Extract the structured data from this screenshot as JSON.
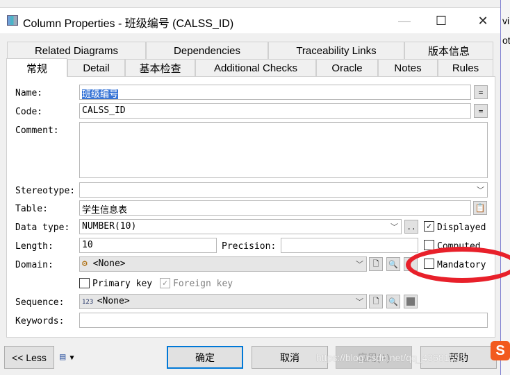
{
  "window": {
    "title": "Column Properties - 班级编号 (CALSS_ID)",
    "minimize": "—",
    "maximize": "☐",
    "close": "✕"
  },
  "background_app": {
    "text1": "vi",
    "text2": "ot"
  },
  "tabs_row1": [
    "Related Diagrams",
    "Dependencies",
    "Traceability Links",
    "版本信息"
  ],
  "tabs_row2": [
    "常规",
    "Detail",
    "基本检查",
    "Additional Checks",
    "Oracle",
    "Notes",
    "Rules"
  ],
  "form": {
    "name_label": "Name:",
    "name_value": "班级编号",
    "code_label": "Code:",
    "code_value": "CALSS_ID",
    "comment_label": "Comment:",
    "comment_value": "",
    "stereotype_label": "Stereotype:",
    "stereotype_value": "",
    "table_label": "Table:",
    "table_value": "学生信息表",
    "datatype_label": "Data type:",
    "datatype_value": "NUMBER(10)",
    "length_label": "Length:",
    "length_value": "10",
    "precision_label": "Precision:",
    "precision_value": "",
    "domain_label": "Domain:",
    "domain_value": "<None>",
    "sequence_label": "Sequence:",
    "sequence_value": "<None>",
    "keywords_label": "Keywords:",
    "keywords_value": "",
    "equals": "=",
    "ellipsis": ".."
  },
  "checkboxes": {
    "displayed": {
      "label": "Displayed",
      "checked": true
    },
    "computed": {
      "label": "Computed",
      "checked": false
    },
    "mandatory": {
      "label": "Mandatory",
      "checked": false
    },
    "primary_key": {
      "label": "Primary key",
      "checked": false
    },
    "foreign_key": {
      "label": "Foreign key",
      "checked": true,
      "disabled": true
    }
  },
  "buttons": {
    "less": "<< Less",
    "ok": "确定",
    "cancel": "取消",
    "apply": "应用(A)",
    "help": "帮助"
  },
  "watermark": "https://blog.csdn.net/qq_43681553",
  "annotation_color": "#e8202a"
}
